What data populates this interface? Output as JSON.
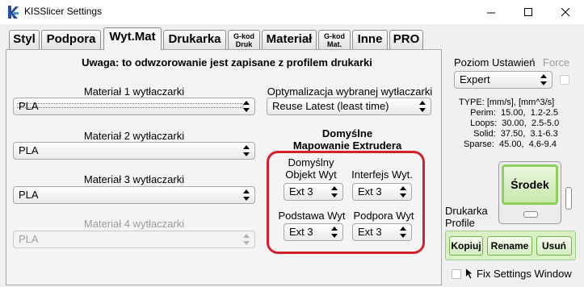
{
  "window": {
    "title": "KISSlicer Settings"
  },
  "tabs": [
    {
      "label": "Styl"
    },
    {
      "label": "Podpora"
    },
    {
      "label": "Wyt.Mat"
    },
    {
      "label": "Drukarka"
    },
    {
      "label_line1": "G-kod",
      "label_line2": "Druk"
    },
    {
      "label": "Materiał"
    },
    {
      "label_line1": "G-kod",
      "label_line2": "Mat."
    },
    {
      "label": "Inne"
    },
    {
      "label": "PRO"
    }
  ],
  "main": {
    "notice": "Uwaga: to odwzorowanie jest zapisane z profilem drukarki",
    "extruder1": {
      "label": "Materiał 1 wytłaczarki",
      "value": "PLA"
    },
    "extruder2": {
      "label": "Materiał 2 wytłaczarki",
      "value": "PLA"
    },
    "extruder3": {
      "label": "Materiał 3 wytłaczarki",
      "value": "PLA"
    },
    "extruder4": {
      "label": "Materiał 4 wytłaczarki",
      "value": "PLA"
    },
    "optimization": {
      "label": "Optymalizacja wybranej wytłaczarki",
      "value": "Reuse Latest (least time)"
    },
    "mapping": {
      "title_line1": "Domyślne",
      "title_line2": "Mapowanie Extrudera",
      "object": {
        "label_line1": "Domyślny",
        "label_line2": "Objekt Wyt",
        "value": "Ext 3"
      },
      "interface": {
        "label": "Interfejs Wyt.",
        "value": "Ext 3"
      },
      "base": {
        "label": "Podstawa Wyt",
        "value": "Ext 3"
      },
      "support": {
        "label": "Podpora Wyt",
        "value": "Ext 3"
      }
    }
  },
  "side": {
    "level_label": "Poziom Ustawień",
    "force_label": "Force",
    "level_value": "Expert",
    "stats": [
      "TYPE: [mm/s], [mm^3/s]",
      "  Perim:  15.00,  1.2-2.5",
      "  Loops:  30.00,  2.5-5.0",
      "  Solid:  37.50,  3.1-6.3",
      "Sparse:  45.00,  4.6-9.4"
    ],
    "center_button": "Środek",
    "profile_label_line1": "Drukarka",
    "profile_label_line2": "Profile",
    "copy_button": "Kopiuj",
    "rename_button": "Rename",
    "delete_button": "Usuń",
    "fix_label": "Fix Settings Window"
  },
  "colors": {
    "highlight": "#d4202a",
    "green_accent": "#8ccf5c"
  }
}
